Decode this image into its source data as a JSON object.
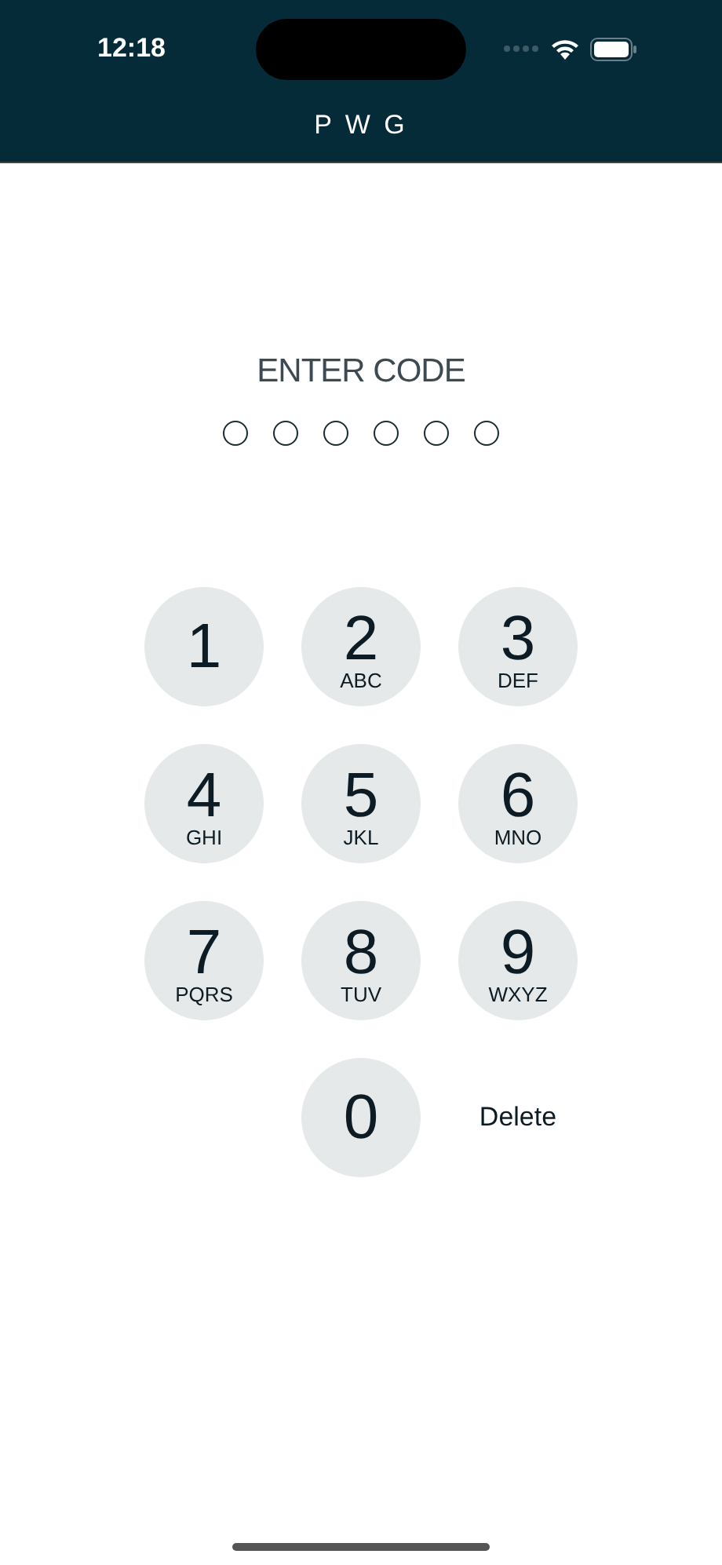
{
  "status_bar": {
    "time": "12:18"
  },
  "header": {
    "title": "P W G"
  },
  "prompt": "ENTER CODE",
  "code_dots": [
    {
      "filled": false
    },
    {
      "filled": false
    },
    {
      "filled": false
    },
    {
      "filled": false
    },
    {
      "filled": false
    },
    {
      "filled": false
    }
  ],
  "keypad": {
    "rows": [
      [
        {
          "kind": "digit",
          "digit": "1"
        },
        {
          "kind": "digit",
          "digit": "2",
          "letters": "ABC"
        },
        {
          "kind": "digit",
          "digit": "3",
          "letters": "DEF"
        }
      ],
      [
        {
          "kind": "digit",
          "digit": "4",
          "letters": "GHI"
        },
        {
          "kind": "digit",
          "digit": "5",
          "letters": "JKL"
        },
        {
          "kind": "digit",
          "digit": "6",
          "letters": "MNO"
        }
      ],
      [
        {
          "kind": "digit",
          "digit": "7",
          "letters": "PQRS"
        },
        {
          "kind": "digit",
          "digit": "8",
          "letters": "TUV"
        },
        {
          "kind": "digit",
          "digit": "9",
          "letters": "WXYZ"
        }
      ],
      [
        "",
        {
          "kind": "digit",
          "digit": "0"
        },
        {
          "kind": "delete",
          "label": "Delete"
        }
      ]
    ]
  }
}
